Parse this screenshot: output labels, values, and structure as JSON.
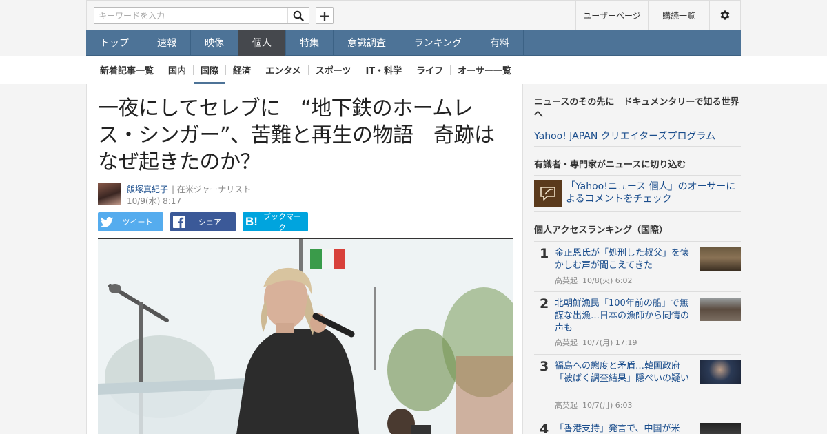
{
  "search": {
    "placeholder": "キーワードを入力",
    "value": ""
  },
  "top_links": {
    "user_page": "ユーザーページ",
    "subscriptions": "購読一覧"
  },
  "main_nav": [
    "トップ",
    "速報",
    "映像",
    "個人",
    "特集",
    "意識調査",
    "ランキング",
    "有料"
  ],
  "main_nav_active": "個人",
  "sub_nav": [
    "新着記事一覧",
    "国内",
    "国際",
    "経済",
    "エンタメ",
    "スポーツ",
    "IT・科学",
    "ライフ",
    "オーサー一覧"
  ],
  "sub_nav_active": "国際",
  "article": {
    "title": "一夜にしてセレブに　“地下鉄のホームレス・シンガー”、苦難と再生の物語　奇跡はなぜ起きたのか？",
    "author_name": "飯塚真紀子",
    "author_role": "| 在米ジャーナリスト",
    "published": "10/9(水) 8:17",
    "share": {
      "twitter": "ツイート",
      "facebook": "シェア",
      "hatena": "ブックマーク"
    }
  },
  "sidebar": {
    "doc_heading": "ニュースのその先に　ドキュメンタリーで知る世界へ",
    "doc_link": "Yahoo! JAPAN クリエイターズプログラム",
    "expert_heading": "有識者・専門家がニュースに切り込む",
    "expert_link": "「Yahoo!ニュース 個人」のオーサーによるコメントをチェック",
    "ranking_heading": "個人アクセスランキング（国際）",
    "ranking": [
      {
        "rank": "1",
        "title": "金正恩氏が「処刑した叔父」を懐かしむ声が聞こえてきた",
        "author": "高英起",
        "time": "10/8(火) 6:02"
      },
      {
        "rank": "2",
        "title": "北朝鮮漁民「100年前の船」で無謀な出漁…日本の漁師から同情の声も",
        "author": "高英起",
        "time": "10/7(月) 17:19"
      },
      {
        "rank": "3",
        "title": "福島への態度と矛盾…韓国政府「被ばく調査結果」隠ぺいの疑い",
        "author": "高英起",
        "time": "10/7(月) 6:03"
      },
      {
        "rank": "4",
        "title": "「香港支持」発言で、中国が米",
        "author": "",
        "time": ""
      }
    ]
  },
  "colors": {
    "nav_bg": "#4d7397",
    "nav_active": "#45484d",
    "link": "#1a4d8c",
    "twitter": "#55acee",
    "facebook": "#3b5998",
    "hatena": "#00a4de"
  }
}
